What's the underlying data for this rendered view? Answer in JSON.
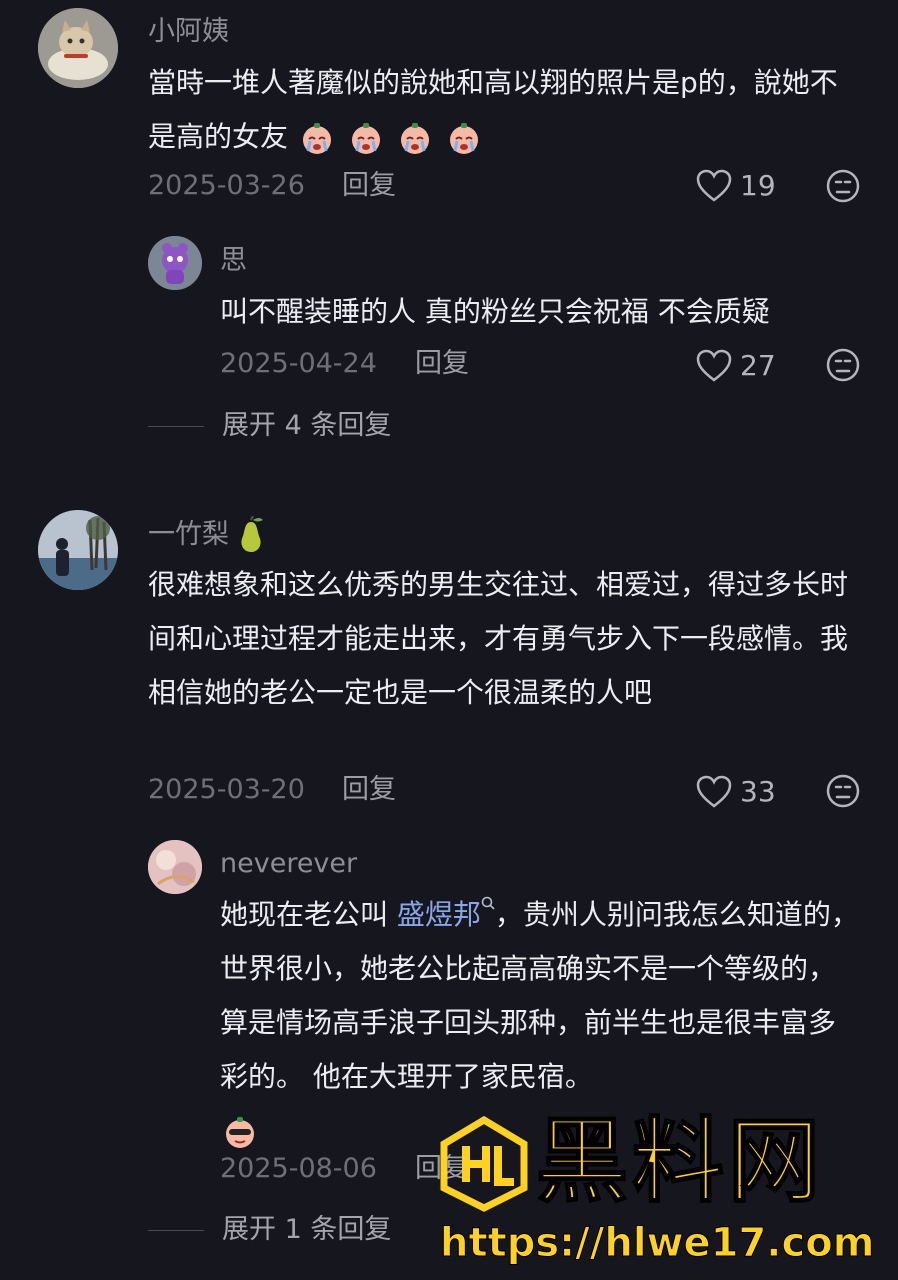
{
  "comments": [
    {
      "user": "小阿姨",
      "text_prefix": "當時一堆人著魔似的說她和高以翔的照片是p的，說她不是高的女友",
      "date": "2025-03-26",
      "reply_label": "回复",
      "likes": "19",
      "avatar_icon": "cat-avatar-icon",
      "emoji_icon": "crying-face-emoji-icon",
      "replies": [
        {
          "user": "思",
          "text": "叫不醒装睡的人 真的粉丝只会祝福 不会质疑",
          "date": "2025-04-24",
          "reply_label": "回复",
          "likes": "27",
          "avatar_icon": "purple-plush-avatar-icon"
        }
      ],
      "expand_label": "展开 4 条回复"
    },
    {
      "user": "一竹梨",
      "name_icon": "pear-icon",
      "text": "很难想象和这么优秀的男生交往过、相爱过，得过多长时间和心理过程才能走出来，才有勇气步入下一段感情。我相信她的老公一定也是一个很温柔的人吧",
      "date": "2025-03-20",
      "reply_label": "回复",
      "likes": "33",
      "avatar_icon": "lakeside-photo-avatar-icon",
      "replies": [
        {
          "user": "neverever",
          "text_before": "她现在老公叫 ",
          "mention": "盛煜邦",
          "text_after": "，贵州人别问我怎么知道的，世界很小，她老公比起高高确实不是一个等级的，算是情场高手浪子回头那种，前半生也是很丰富多彩的。 他在大理开了家民宿。",
          "date": "2025-08-06",
          "reply_label": "回复",
          "avatar_icon": "pink-floral-avatar-icon",
          "emoji_icon": "cool-face-emoji-icon"
        }
      ],
      "expand_label": "展开 1 条回复"
    }
  ],
  "watermark": {
    "logo_text": "黑料网",
    "url": "https://hlwe17.com",
    "color": "#ffd21f"
  }
}
